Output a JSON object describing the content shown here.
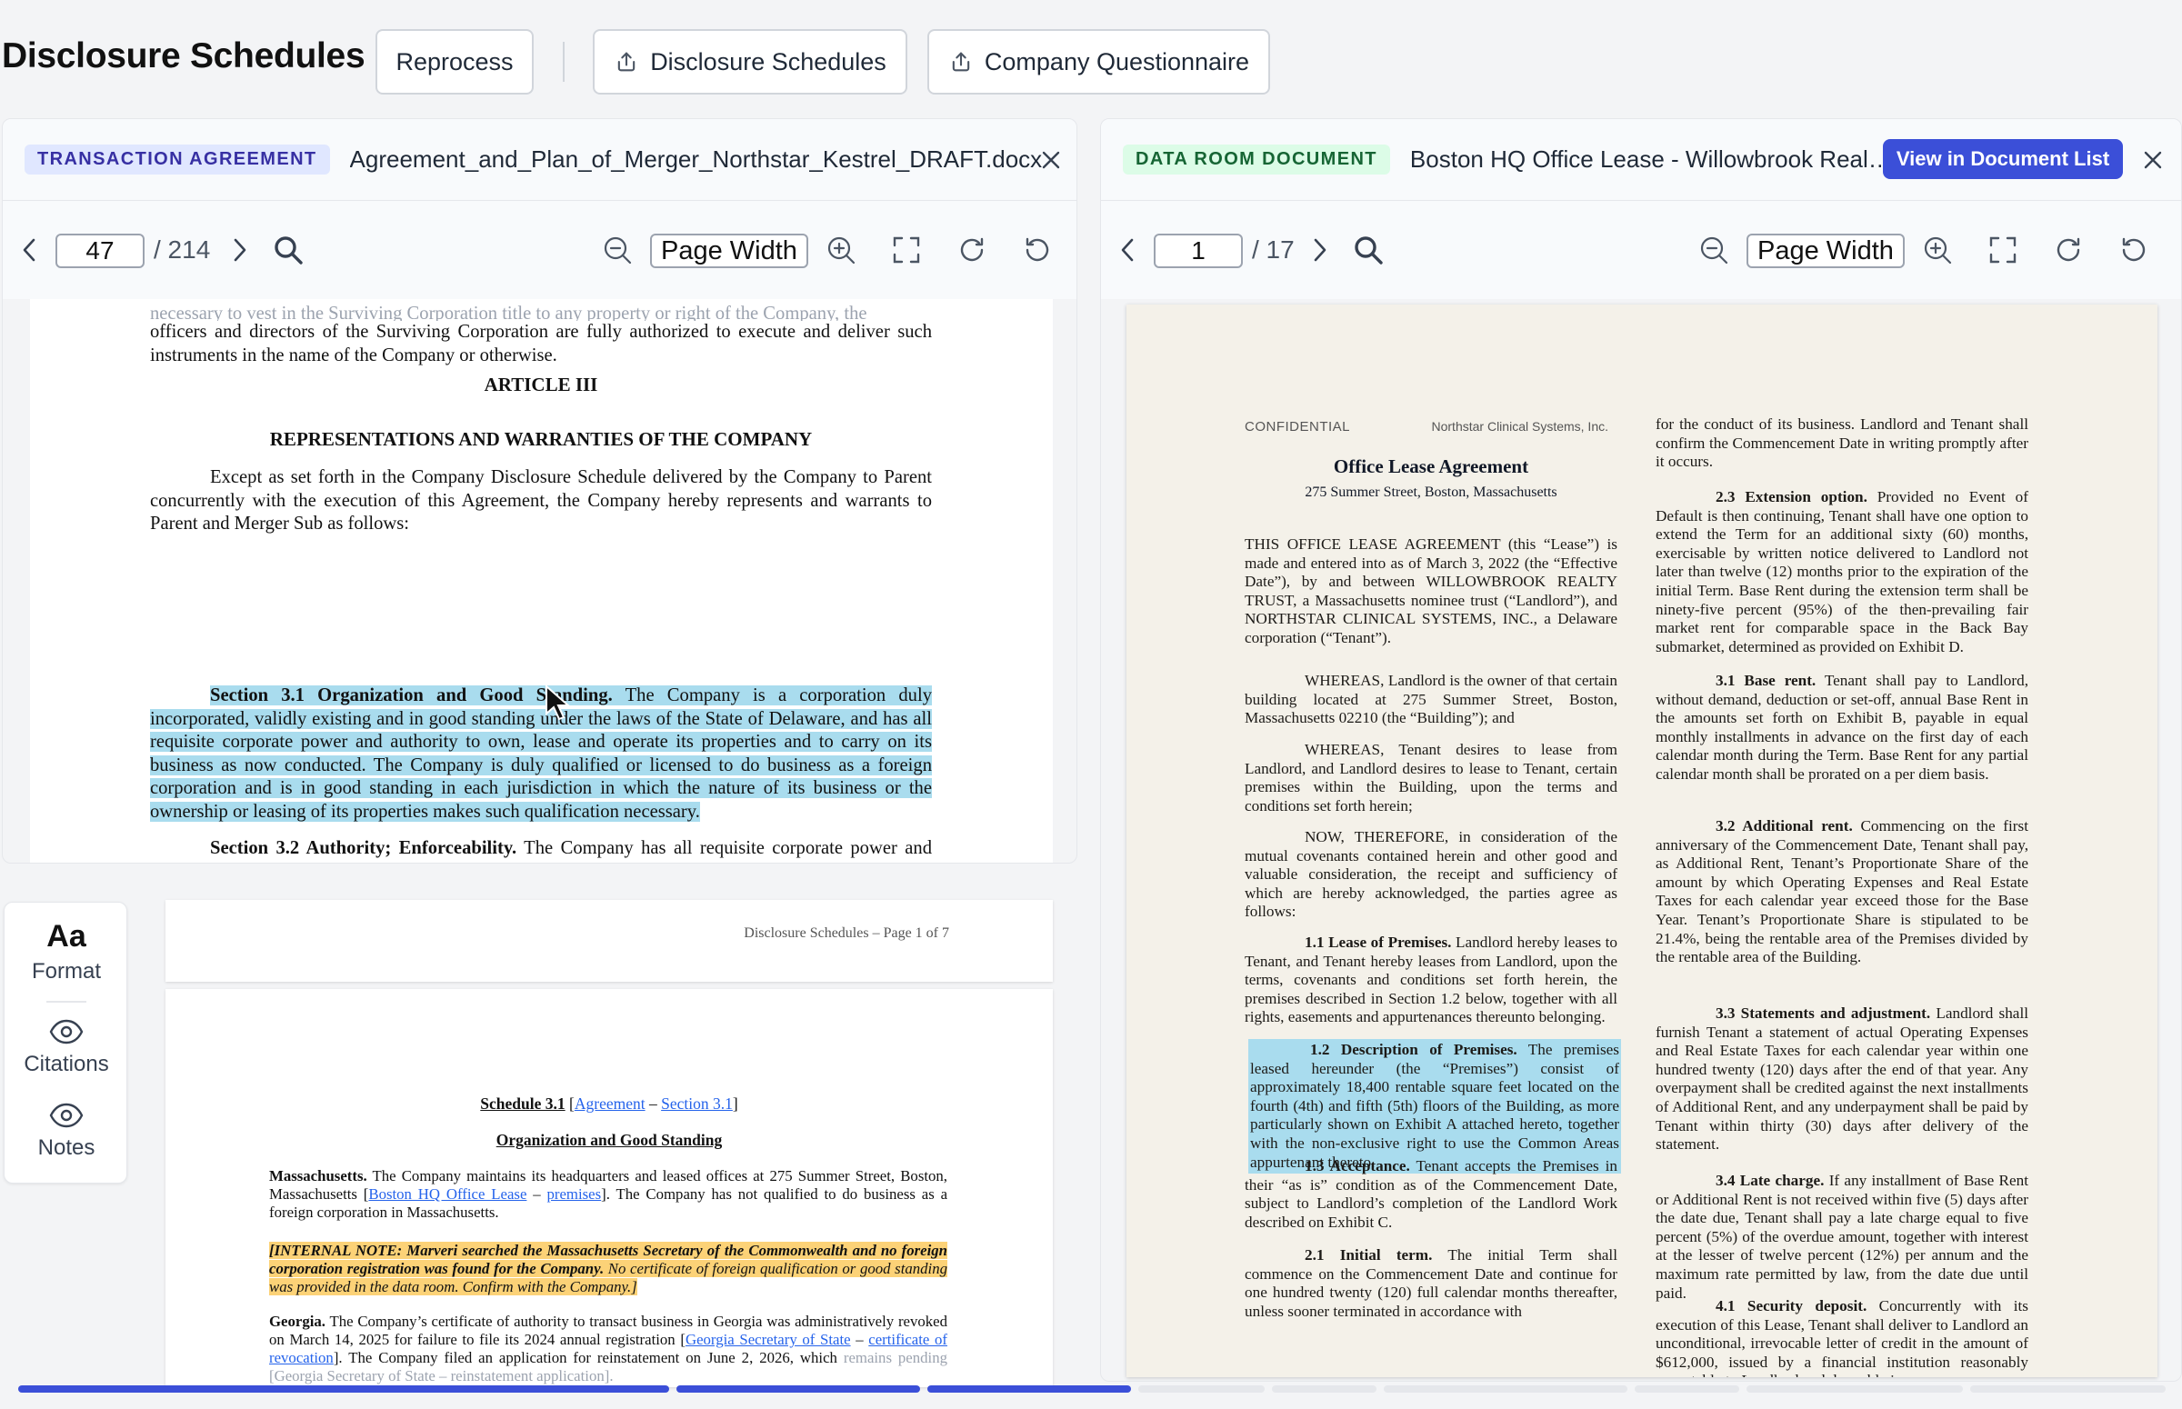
{
  "header": {
    "title": "Disclosure Schedules",
    "reprocess_label": "Reprocess",
    "upload_disclosure_label": "Disclosure Schedules",
    "upload_questionnaire_label": "Company Questionnaire"
  },
  "left_panel": {
    "tag": "TRANSACTION AGREEMENT",
    "filename": "Agreement_and_Plan_of_Merger_Northstar_Kestrel_DRAFT.docx",
    "page_current": "47",
    "page_total": "/ 214",
    "zoom": "Page Width",
    "doc": {
      "p0_faint": "necessary to vest in the Surviving Corporation title to any property or right of the Company, the",
      "p0": "officers and directors of the Surviving Corporation are fully authorized to execute and deliver such instruments in the name of the Company or otherwise.",
      "article": "ARTICLE III",
      "article_title": "REPRESENTATIONS AND WARRANTIES OF THE COMPANY",
      "intro": "Except as set forth in the Company Disclosure Schedule delivered by the Company to Parent concurrently with the execution of this Agreement, the Company hereby represents and warrants to Parent and Merger Sub as follows:",
      "s31_heading": "Section 3.1   Organization and Good Standing.",
      "s31_body": " The Company is a corporation duly incorporated, validly existing and in good standing under the laws of the State of Delaware, and has all requisite corporate power and authority to own, lease and operate its properties and to carry on its business as now conducted. The Company is duly qualified or licensed to do business as a foreign corporation and is in good standing in each jurisdiction in which the nature of its business or the ownership or leasing of its properties makes such qualification necessary.",
      "s32_heading": "Section 3.2   Authority; Enforceability.",
      "s32_body": " The Company has all requisite corporate power and authority to execute and deliver this Agreement, to perform its obligations hereunder and to consummate the transactions contemplated hereby, subject only to receipt of the Company Stockholder Approval. The execution and delivery of this Agreement, the performance by the Company of its obligations hereunder and the consummation of the transactions contemplated hereby have been duly and validly authorized by all necessary corporate action on the part of the"
    }
  },
  "side_tools": {
    "format_glyph": "Aa",
    "format_label": "Format",
    "citations_label": "Citations",
    "notes_label": "Notes"
  },
  "schedule": {
    "page_footer": "Disclosure Schedules – Page 1 of 7",
    "heading_prefix": "Schedule 3.1",
    "heading_link1": "Agreement",
    "heading_dash": " – ",
    "heading_link2": "Section 3.1",
    "subheading": "Organization and Good Standing",
    "ma_label": "Massachusetts.",
    "ma_text1": " The Company maintains its headquarters and leased offices at 275 Summer Street, Boston, Massachusetts [",
    "ma_link1": "Boston HQ Office Lease",
    "ma_dash": " – ",
    "ma_link2": "premises",
    "ma_text2": "]. The Company has not qualified to do business as a foreign corporation in Massachusetts.",
    "note_bold": "[INTERNAL NOTE: Marveri searched the Massachusetts Secretary of the Commonwealth and no foreign corporation registration was found for the Company.",
    "note_rest": " No certificate of foreign qualification or good standing was provided in the data room. Confirm with the Company.]",
    "ga_label": "Georgia.",
    "ga_text1": " The Company’s certificate of authority to transact business in Georgia was administratively revoked on March 14, 2025 for failure to file its 2024 annual registration [",
    "ga_link1": "Georgia Secretary of State",
    "ga_dash": " – ",
    "ga_link2": "certificate of revocation",
    "ga_text2": "]. The Company filed an application for reinstatement on June 2, 2026, which",
    "ga_faint": "remains pending [Georgia Secretary of State – reinstatement application]."
  },
  "right_panel": {
    "tag": "DATA ROOM DOCUMENT",
    "filename": "Boston HQ Office Lease - Willowbrook Realty Tr...",
    "view_button": "View in Document List",
    "page_current": "1",
    "page_total": "/ 17",
    "zoom": "Page Width",
    "lease": {
      "confidential": "CONFIDENTIAL",
      "company": "Northstar Clinical Systems, Inc.",
      "title": "Office Lease Agreement",
      "address": "275 Summer Street, Boston, Massachusetts",
      "p1": "THIS OFFICE LEASE AGREEMENT (this “Lease”) is made and entered into as of March 3, 2022 (the “Effective Date”), by and between WILLOWBROOK REALTY TRUST, a Massachusetts nominee trust (“Landlord”), and NORTHSTAR CLINICAL SYSTEMS, INC., a Delaware corporation (“Tenant”).",
      "p2": "WHEREAS, Landlord is the owner of that certain building located at 275 Summer Street, Boston, Massachusetts 02210 (the “Building”); and",
      "p3": "WHEREAS, Tenant desires to lease from Landlord, and Landlord desires to lease to Tenant, certain premises within the Building, upon the terms and conditions set forth herein;",
      "p4": "NOW, THEREFORE, in consideration of the mutual covenants contained herein and other good and valuable consideration, the receipt and sufficiency of which are hereby acknowledged, the parties agree as follows:",
      "s11_h": "1.1   Lease of Premises.",
      "s11": " Landlord hereby leases to Tenant, and Tenant hereby leases from Landlord, upon the terms, covenants and conditions set forth herein, the premises described in Section 1.2 below, together with all rights, easements and appurtenances thereunto belonging.",
      "s12_h": "1.2   Description of Premises.",
      "s12": " The premises leased hereunder (the “Premises”) consist of approximately 18,400 rentable square feet located on the fourth (4th) and fifth (5th) floors of the Building, as more particularly shown on Exhibit A attached hereto, together with the non-exclusive right to use the Common Areas appurtenant thereto.",
      "s13_h": "1.3   Acceptance.",
      "s13": " Tenant accepts the Premises in their “as is” condition as of the Commencement Date, subject to Landlord’s completion of the Landlord Work described on Exhibit C.",
      "s21_h": "2.1   Initial term.",
      "s21": " The initial Term shall commence on the Commencement Date and continue for one hundred twenty (120) full calendar months thereafter, unless sooner terminated in accordance with",
      "c2_p0": "for the conduct of its business. Landlord and Tenant shall confirm the Commencement Date in writing promptly after it occurs.",
      "s23_h": "2.3   Extension option.",
      "s23": " Provided no Event of Default is then continuing, Tenant shall have one option to extend the Term for an additional sixty (60) months, exercisable by written notice delivered to Landlord not later than twelve (12) months prior to the expiration of the initial Term. Base Rent during the extension term shall be ninety-five percent (95%) of the then-prevailing fair market rent for comparable space in the Back Bay submarket, determined as provided on Exhibit D.",
      "s31_h": "3.1   Base rent.",
      "s31": " Tenant shall pay to Landlord, without demand, deduction or set-off, annual Base Rent in the amounts set forth on Exhibit B, payable in equal monthly installments in advance on the first day of each calendar month during the Term. Base Rent for any partial calendar month shall be prorated on a per diem basis.",
      "s32_h": "3.2   Additional rent.",
      "s32": " Commencing on the first anniversary of the Commencement Date, Tenant shall pay, as Additional Rent, Tenant’s Proportionate Share of the amount by which Operating Expenses and Real Estate Taxes for each calendar year exceed those for the Base Year. Tenant’s Proportionate Share is stipulated to be 21.4%, being the rentable area of the Premises divided by the rentable area of the Building.",
      "s33_h": "3.3   Statements and adjustment.",
      "s33": " Landlord shall furnish Tenant a statement of actual Operating Expenses and Real Estate Taxes for each calendar year within one hundred twenty (120) days after the end of that year. Any overpayment shall be credited against the next installments of Additional Rent, and any underpayment shall be paid by Tenant within thirty (30) days after delivery of the statement.",
      "s34_h": "3.4   Late charge.",
      "s34": " If any installment of Base Rent or Additional Rent is not received within five (5) days after the date due, Tenant shall pay a late charge equal to five percent (5%) of the overdue amount, together with interest at the lesser of twelve percent (12%) per annum and the maximum rate permitted by law, from the date due until paid.",
      "s41_h": "4.1   Security deposit.",
      "s41": " Concurrently with its execution of this Lease, Tenant shall deliver to Landlord an unconditional, irrevocable letter of credit in the amount of $612,000, issued by a financial institution reasonably acceptable to Landlord and drawable in"
    }
  },
  "progress": {
    "segments_done": 3,
    "segments_total": 9
  },
  "colors": {
    "accent": "#3b4fd8",
    "highlight_blue": "#a9dcee",
    "highlight_yellow": "#fcd277",
    "paper_lease": "#f4f1e9"
  }
}
